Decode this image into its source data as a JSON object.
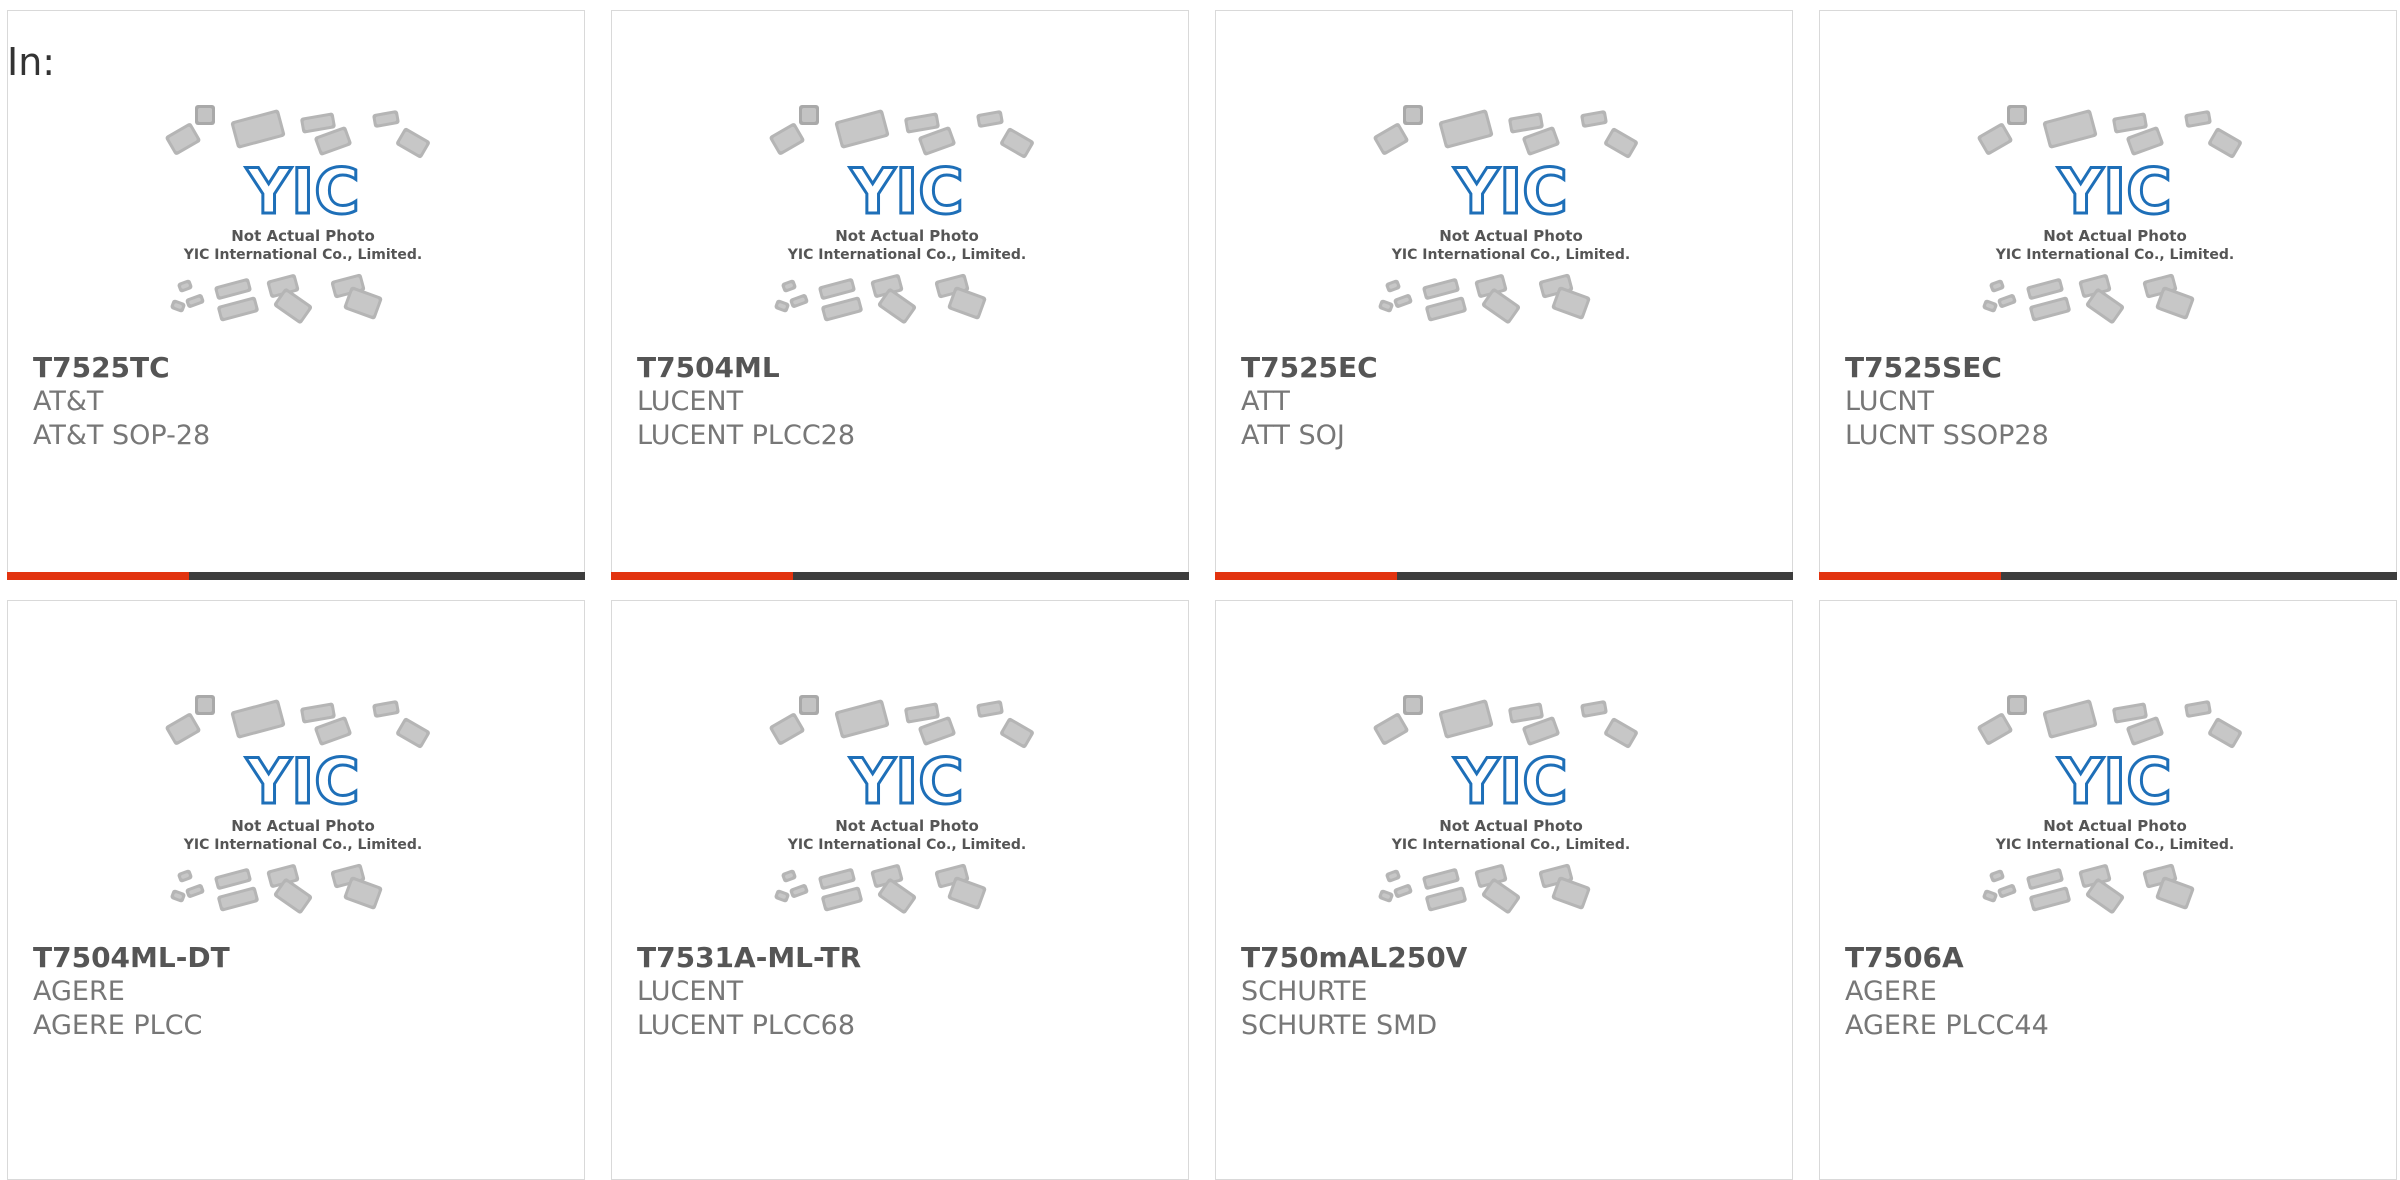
{
  "header": {
    "label": "In:"
  },
  "colors": {
    "accent": "#e2330f",
    "bar": "#3d3d3d",
    "logo": "#1e6fb8"
  },
  "placeholder": {
    "line1": "Not Actual Photo",
    "line2": "YIC International Co., Limited.",
    "logo_text": "YIC"
  },
  "products": [
    {
      "part": "T7525TC",
      "manufacturer": "AT&T",
      "package": "AT&T SOP-28"
    },
    {
      "part": "T7504ML",
      "manufacturer": "LUCENT",
      "package": "LUCENT PLCC28"
    },
    {
      "part": "T7525EC",
      "manufacturer": "ATT",
      "package": "ATT SOJ"
    },
    {
      "part": "T7525SEC",
      "manufacturer": "LUCNT",
      "package": "LUCNT SSOP28"
    },
    {
      "part": "T7504ML-DT",
      "manufacturer": "AGERE",
      "package": "AGERE PLCC"
    },
    {
      "part": "T7531A-ML-TR",
      "manufacturer": "LUCENT",
      "package": "LUCENT PLCC68"
    },
    {
      "part": "T750mAL250V",
      "manufacturer": "SCHURTE",
      "package": "SCHURTE SMD"
    },
    {
      "part": "T7506A",
      "manufacturer": "AGERE",
      "package": "AGERE PLCC44"
    }
  ]
}
